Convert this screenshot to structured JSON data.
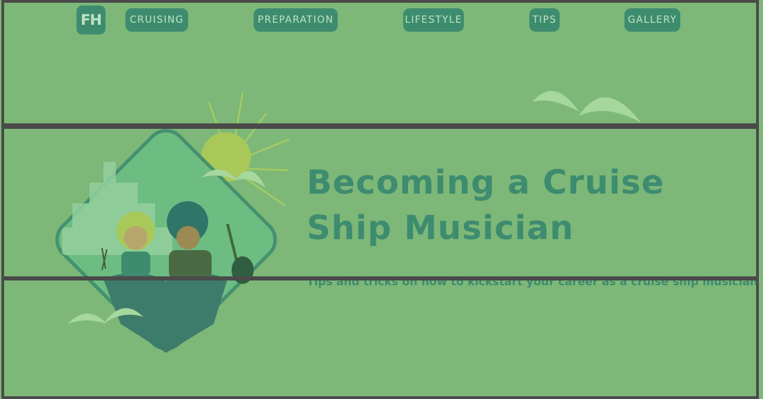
{
  "nav": {
    "logo": "FH",
    "items": [
      {
        "label": "CRUISING"
      },
      {
        "label": "PREPARATION"
      },
      {
        "label": "LIFESTYLE"
      },
      {
        "label": "TIPS"
      },
      {
        "label": "GALLERY"
      }
    ]
  },
  "hero": {
    "title": "Becoming a Cruise Ship Musician",
    "subtitle": "Tips and tricks on how to kickstart your career as a cruise ship musician"
  },
  "colors": {
    "background": "#7db878",
    "accent": "#3e8c6f",
    "accent_text": "#bfe3c4",
    "divider": "#4a4a4a"
  }
}
